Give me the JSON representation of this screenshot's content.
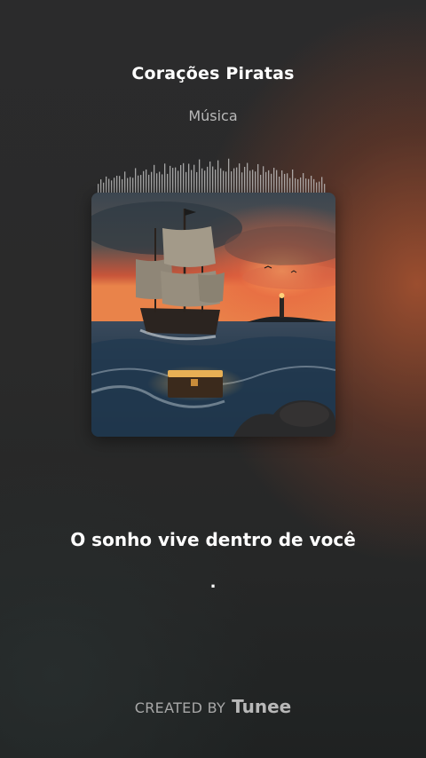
{
  "song": {
    "title": "Corações Piratas",
    "genre": "Música"
  },
  "lyrics": {
    "current_line": "O sonho vive dentro de você",
    "next_indicator": "."
  },
  "footer": {
    "created_by": "CREATED BY",
    "brand": "Tunee"
  },
  "cover_art": {
    "icon": "album-cover-pirate-ship"
  },
  "colors": {
    "accent_glow": "#af5430",
    "background": "#2a2a2a",
    "text_primary": "#ffffff",
    "text_secondary": "#b9b9b9",
    "waveform": "#cfcfcf"
  }
}
